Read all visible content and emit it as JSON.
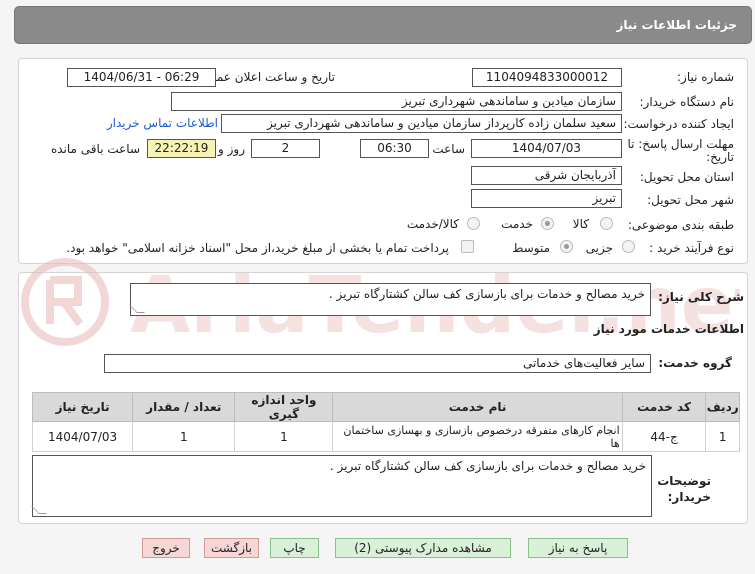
{
  "header": {
    "title": "جزئیات اطلاعات نیاز"
  },
  "watermark": {
    "text": "AriaTender.net"
  },
  "fields": {
    "need_number_label": "شماره نیاز:",
    "need_number": "1104094833000012",
    "announce_label": "تاریخ و ساعت اعلان عمومی:",
    "announce_value": "1404/06/31 - 06:29",
    "buyer_org_label": "نام دستگاه خریدار:",
    "buyer_org": "سازمان میادین و ساماندهی شهرداری تبریز",
    "creator_label": "ایجاد کننده درخواست:",
    "creator": "سعید سلمان زاده کارپرداز سازمان میادین و ساماندهی شهرداری تبریز",
    "contact_link": "اطلاعات تماس خریدار",
    "deadline_label_1": "مهلت ارسال پاسخ: تا",
    "deadline_label_2": "تاریخ:",
    "deadline_date": "1404/07/03",
    "time_label": "ساعت",
    "deadline_time": "06:30",
    "days_value": "2",
    "days_label": "روز و",
    "remaining_time": "22:22:19",
    "remaining_label": "ساعت باقی مانده",
    "province_label": "استان محل تحویل:",
    "province": "آذربایجان شرقی",
    "city_label": "شهر محل تحویل:",
    "city": "تبریز",
    "category_label": "طبقه بندی موضوعی:",
    "category_options": [
      "کالا",
      "خدمت",
      "کالا/خدمت"
    ],
    "process_label": "نوع فرآیند خرید :",
    "process_options": [
      "جزیی",
      "متوسط"
    ],
    "payment_note": "پرداخت تمام یا بخشی از مبلغ خرید،از محل \"اسناد خزانه اسلامی\" خواهد بود."
  },
  "needs": {
    "summary_label": "شرح کلی نیاز:",
    "summary": "خرید مصالح و خدمات برای بازسازی کف سالن کشتارگاه تبریز .",
    "services_title": "اطلاعات خدمات مورد نیاز",
    "service_group_label": "گروه خدمت:",
    "service_group": "سایر فعالیت‌های خدماتی",
    "table": {
      "headers": [
        "ردیف",
        "کد خدمت",
        "نام خدمت",
        "واحد اندازه گیری",
        "تعداد / مقدار",
        "تاریخ نیاز"
      ],
      "rows": [
        [
          "1",
          "ج-44",
          "انجام کارهای متفرقه درخصوص بازسازی و بهسازی ساختمان ها",
          "1",
          "1",
          "1404/07/03"
        ]
      ]
    },
    "buyer_notes_label_1": "توضیحات",
    "buyer_notes_label_2": "خریدار:",
    "buyer_notes": "خرید مصالح و خدمات برای بازسازی کف سالن کشتارگاه تبریز ."
  },
  "buttons": {
    "reply": "پاسخ به نیاز",
    "attachments": "مشاهده مدارک پیوستی (2)",
    "print": "چاپ",
    "back": "بازگشت",
    "exit": "خروج"
  }
}
